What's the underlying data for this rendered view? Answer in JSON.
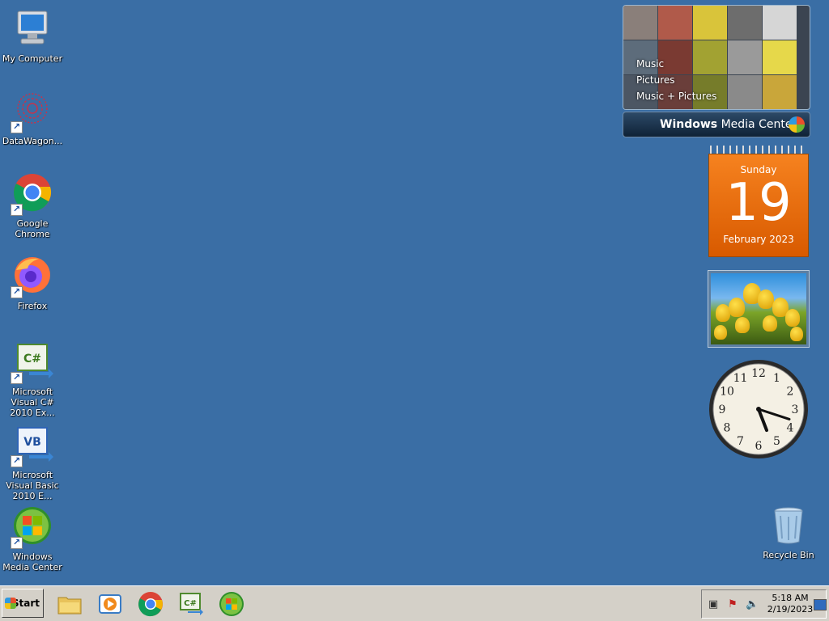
{
  "desktop_icons": [
    {
      "label": "My Computer",
      "icon": "my-computer-icon",
      "shortcut": false
    },
    {
      "label": "DataWagon...",
      "icon": "datawagon-icon",
      "shortcut": true
    },
    {
      "label": "Google Chrome",
      "icon": "chrome-icon",
      "shortcut": true
    },
    {
      "label": "Firefox",
      "icon": "firefox-icon",
      "shortcut": true
    },
    {
      "label": "Microsoft Visual C# 2010 Ex...",
      "icon": "visual-csharp-icon",
      "shortcut": true
    },
    {
      "label": "Microsoft Visual Basic 2010 E...",
      "icon": "visual-basic-icon",
      "shortcut": true
    },
    {
      "label": "Windows Media Center",
      "icon": "windows-media-center-icon",
      "shortcut": true
    }
  ],
  "recycle_bin": {
    "label": "Recycle Bin",
    "icon": "recycle-bin-icon"
  },
  "media_center_gadget": {
    "menu": [
      "Music",
      "Pictures",
      "Music + Pictures"
    ],
    "title_bold": "Windows",
    "title_rest": " Media Center"
  },
  "calendar_gadget": {
    "weekday": "Sunday",
    "day": "19",
    "month_year": "February 2023"
  },
  "clock_gadget": {
    "hour": 5,
    "minute": 18
  },
  "taskbar": {
    "start_label": "Start",
    "pinned": [
      "explorer-icon",
      "media-player-icon",
      "chrome-icon",
      "visual-csharp-icon",
      "windows-media-center-icon"
    ],
    "clock_time": "5:18 AM",
    "clock_date": "2/19/2023",
    "tray_icons": [
      "network-icon",
      "action-center-icon",
      "volume-icon",
      "show-desktop-icon"
    ]
  },
  "colors": {
    "desktop": "#3a6ea5",
    "taskbar": "#d4d0c8",
    "calendar": "#f6821f"
  }
}
